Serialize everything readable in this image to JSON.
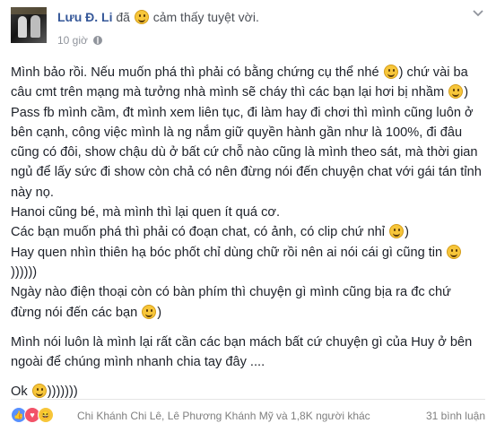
{
  "header": {
    "author": "Lưu Đ. Li",
    "feeling_prefix": "đã",
    "feeling_text": "cảm thấy tuyệt vời.",
    "time": "10 giờ",
    "feeling_icon": "smile-emoji",
    "privacy_icon": "globe-icon",
    "menu_icon": "chevron-down-icon"
  },
  "post": {
    "p1_a": "Mình bảo rồi. Nếu muốn phá thì phải có bằng chứng cụ thể nhé",
    "p1_b": ") chứ vài ba câu cmt trên mạng mà tưởng nhà mình sẽ cháy thì các bạn lại hơi bị nhầm",
    "p1_c": ")",
    "p2": "Pass fb mình cầm, đt mình xem liên tục, đi làm hay đi chơi thì mình cũng luôn ở bên cạnh, công việc mình là ng nắm giữ quyền hành gần như là 100%, đi đâu cũng có đôi, show chậu dù ở bất cứ chỗ nào cũng là mình theo sát, mà thời gian ngủ để lấy sức đi show còn chả có nên đừng nói đến chuyện chat với gái tán tỉnh này nọ.",
    "p3": "Hanoi cũng bé, mà mình thì lại quen ít quá cơ.",
    "p4_a": "Các bạn muốn phá thì phải có đoạn chat, có ảnh, có clip chứ nhỉ",
    "p4_b": ")",
    "p5_a": "Hay quen nhìn thiên hạ bóc phốt chỉ dùng chữ rồi nên ai nói cái gì cũng tin",
    "p5_b": "))))))",
    "p6_a": "Ngày nào điện thoại còn có bàn phím thì chuyện gì mình cũng bịa ra đc chứ đừng nói đến các bạn",
    "p6_b": ")",
    "p7": "Mình nói luôn là mình lại rất cần các bạn mách bất cứ chuyện gì của Huy ở bên ngoài để chúng mình nhanh chia tay đây ....",
    "p8_a": "Ok",
    "p8_b": ")))))))"
  },
  "footer": {
    "reactions": [
      "like",
      "love",
      "haha"
    ],
    "reaction_glyphs": [
      "👍",
      "♥",
      "😆"
    ],
    "reacted_by": "Chi Khánh Chi Lê, Lê Phương Khánh Mỹ và 1,8K người khác",
    "comments": "31 bình luận"
  },
  "colors": {
    "author": "#365899",
    "text": "#1d2129",
    "meta": "#90949c",
    "like": "#5890ff",
    "love": "#f25268",
    "haha": "#f7c63a"
  }
}
